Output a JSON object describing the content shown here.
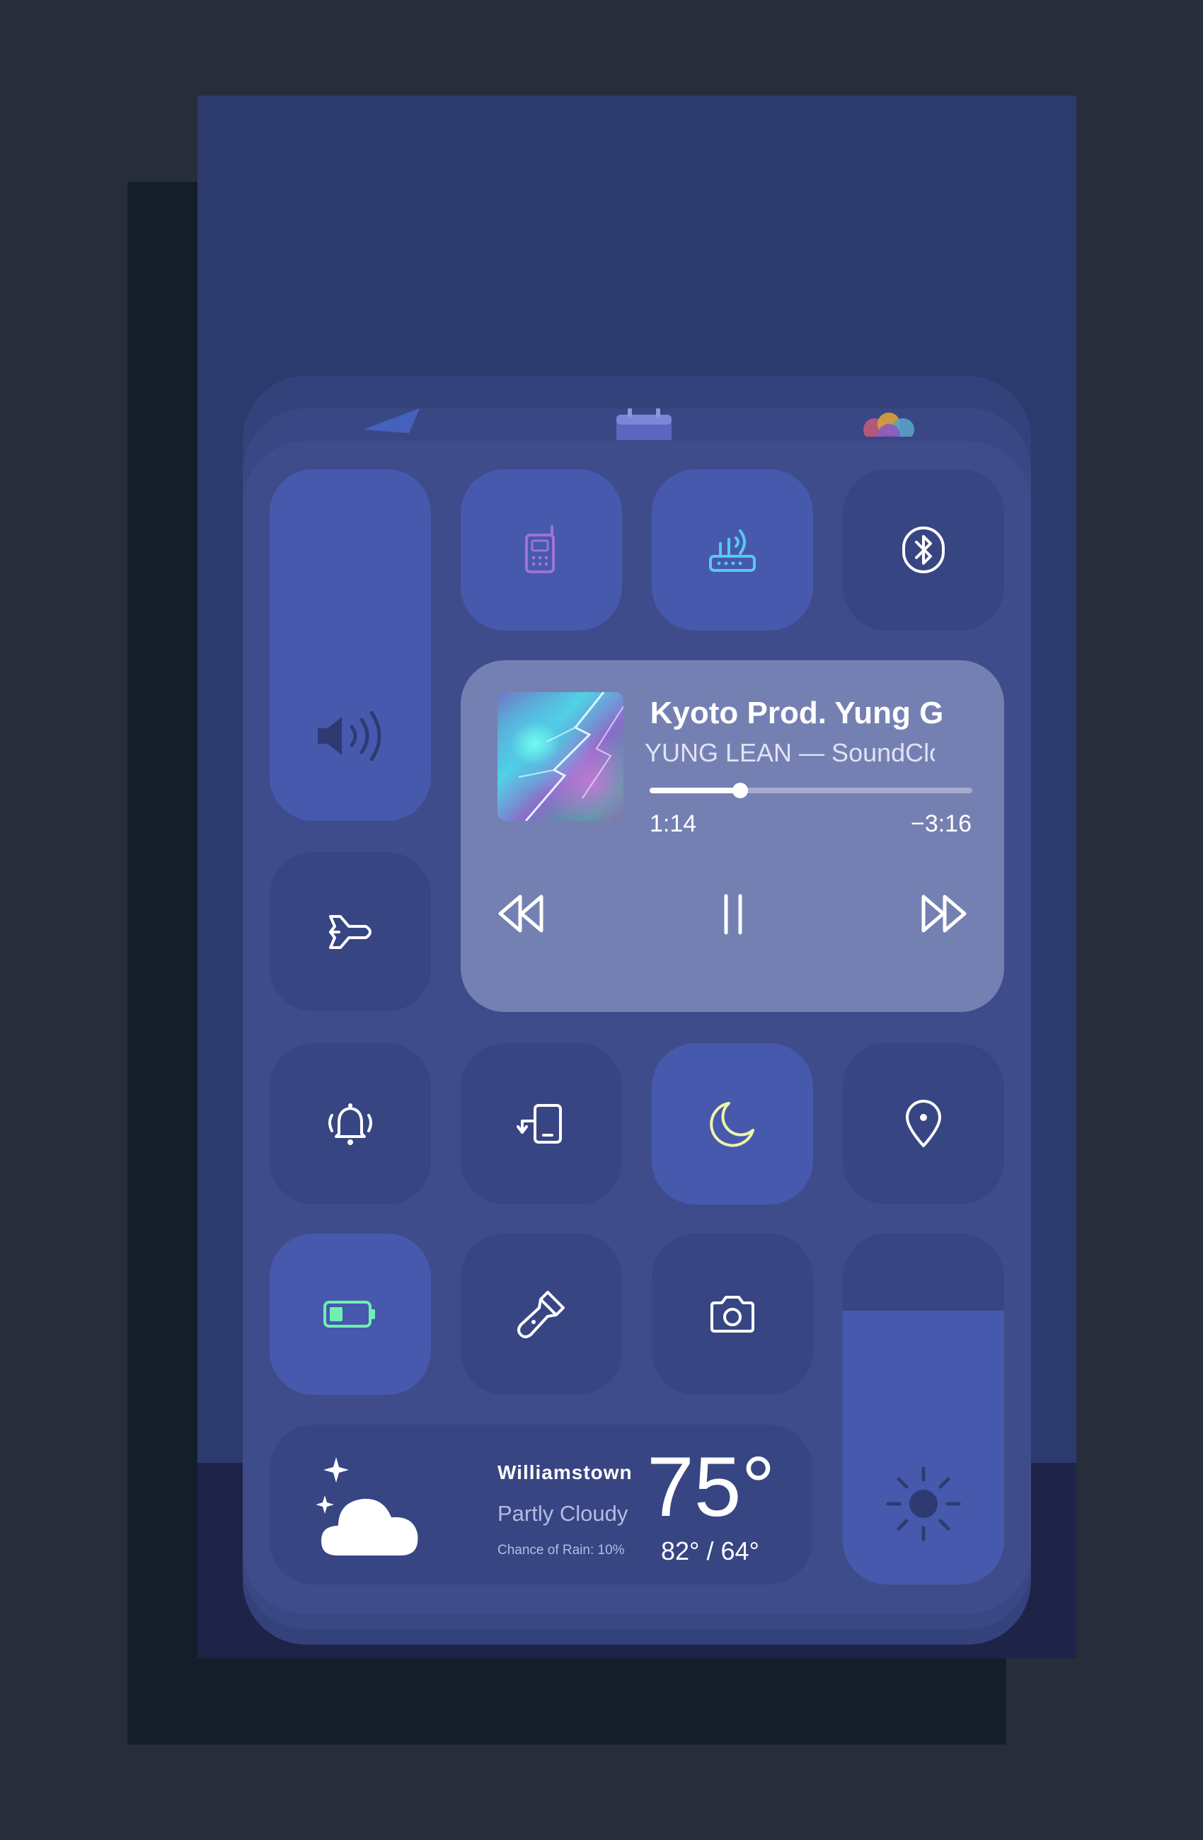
{
  "music": {
    "title": "Kyoto Prod. Yung G",
    "artist": "YUNG LEAN — SoundClo",
    "elapsed": "1:14",
    "remaining": "−3:16",
    "progress": 0.28
  },
  "weather": {
    "city": "Williamstown",
    "condition": "Partly Cloudy",
    "rain": "Chance of Rain: 10%",
    "temp": "75°",
    "high_low": "82° / 64°"
  },
  "brightness": {
    "level": 0.78
  },
  "volume": {
    "level": 0
  },
  "toggles": {
    "cellular": true,
    "wifi": true,
    "bluetooth": false,
    "airplane": false,
    "alarm": false,
    "rotation": false,
    "do_not_disturb": true,
    "location": false,
    "low_power": true,
    "flashlight": false,
    "camera": false
  },
  "colors": {
    "cellular_icon": "#9b74d8",
    "wifi_icon": "#59c8f0",
    "moon_icon": "#eef5a8",
    "battery_icon": "#6df0b0"
  },
  "icons": [
    "paper-plane-icon",
    "calendar-icon",
    "photos-icon",
    "volume-icon",
    "cellular-phone-icon",
    "wifi-router-icon",
    "bluetooth-icon",
    "airplane-icon",
    "alarm-bell-icon",
    "screen-rotation-icon",
    "moon-icon",
    "location-pin-icon",
    "battery-icon",
    "flashlight-icon",
    "camera-icon",
    "weather-cloud-moon-icon",
    "brightness-sun-icon",
    "rewind-icon",
    "pause-icon",
    "fast-forward-icon"
  ]
}
